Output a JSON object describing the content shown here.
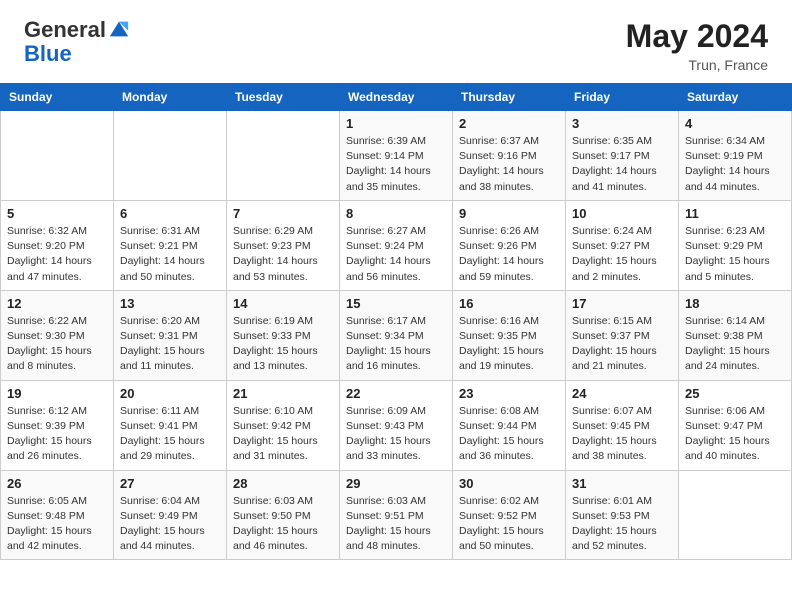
{
  "header": {
    "logo_general": "General",
    "logo_blue": "Blue",
    "month_year": "May 2024",
    "location": "Trun, France"
  },
  "days_of_week": [
    "Sunday",
    "Monday",
    "Tuesday",
    "Wednesday",
    "Thursday",
    "Friday",
    "Saturday"
  ],
  "weeks": [
    [
      {
        "day": "",
        "info": ""
      },
      {
        "day": "",
        "info": ""
      },
      {
        "day": "",
        "info": ""
      },
      {
        "day": "1",
        "info": "Sunrise: 6:39 AM\nSunset: 9:14 PM\nDaylight: 14 hours\nand 35 minutes."
      },
      {
        "day": "2",
        "info": "Sunrise: 6:37 AM\nSunset: 9:16 PM\nDaylight: 14 hours\nand 38 minutes."
      },
      {
        "day": "3",
        "info": "Sunrise: 6:35 AM\nSunset: 9:17 PM\nDaylight: 14 hours\nand 41 minutes."
      },
      {
        "day": "4",
        "info": "Sunrise: 6:34 AM\nSunset: 9:19 PM\nDaylight: 14 hours\nand 44 minutes."
      }
    ],
    [
      {
        "day": "5",
        "info": "Sunrise: 6:32 AM\nSunset: 9:20 PM\nDaylight: 14 hours\nand 47 minutes."
      },
      {
        "day": "6",
        "info": "Sunrise: 6:31 AM\nSunset: 9:21 PM\nDaylight: 14 hours\nand 50 minutes."
      },
      {
        "day": "7",
        "info": "Sunrise: 6:29 AM\nSunset: 9:23 PM\nDaylight: 14 hours\nand 53 minutes."
      },
      {
        "day": "8",
        "info": "Sunrise: 6:27 AM\nSunset: 9:24 PM\nDaylight: 14 hours\nand 56 minutes."
      },
      {
        "day": "9",
        "info": "Sunrise: 6:26 AM\nSunset: 9:26 PM\nDaylight: 14 hours\nand 59 minutes."
      },
      {
        "day": "10",
        "info": "Sunrise: 6:24 AM\nSunset: 9:27 PM\nDaylight: 15 hours\nand 2 minutes."
      },
      {
        "day": "11",
        "info": "Sunrise: 6:23 AM\nSunset: 9:29 PM\nDaylight: 15 hours\nand 5 minutes."
      }
    ],
    [
      {
        "day": "12",
        "info": "Sunrise: 6:22 AM\nSunset: 9:30 PM\nDaylight: 15 hours\nand 8 minutes."
      },
      {
        "day": "13",
        "info": "Sunrise: 6:20 AM\nSunset: 9:31 PM\nDaylight: 15 hours\nand 11 minutes."
      },
      {
        "day": "14",
        "info": "Sunrise: 6:19 AM\nSunset: 9:33 PM\nDaylight: 15 hours\nand 13 minutes."
      },
      {
        "day": "15",
        "info": "Sunrise: 6:17 AM\nSunset: 9:34 PM\nDaylight: 15 hours\nand 16 minutes."
      },
      {
        "day": "16",
        "info": "Sunrise: 6:16 AM\nSunset: 9:35 PM\nDaylight: 15 hours\nand 19 minutes."
      },
      {
        "day": "17",
        "info": "Sunrise: 6:15 AM\nSunset: 9:37 PM\nDaylight: 15 hours\nand 21 minutes."
      },
      {
        "day": "18",
        "info": "Sunrise: 6:14 AM\nSunset: 9:38 PM\nDaylight: 15 hours\nand 24 minutes."
      }
    ],
    [
      {
        "day": "19",
        "info": "Sunrise: 6:12 AM\nSunset: 9:39 PM\nDaylight: 15 hours\nand 26 minutes."
      },
      {
        "day": "20",
        "info": "Sunrise: 6:11 AM\nSunset: 9:41 PM\nDaylight: 15 hours\nand 29 minutes."
      },
      {
        "day": "21",
        "info": "Sunrise: 6:10 AM\nSunset: 9:42 PM\nDaylight: 15 hours\nand 31 minutes."
      },
      {
        "day": "22",
        "info": "Sunrise: 6:09 AM\nSunset: 9:43 PM\nDaylight: 15 hours\nand 33 minutes."
      },
      {
        "day": "23",
        "info": "Sunrise: 6:08 AM\nSunset: 9:44 PM\nDaylight: 15 hours\nand 36 minutes."
      },
      {
        "day": "24",
        "info": "Sunrise: 6:07 AM\nSunset: 9:45 PM\nDaylight: 15 hours\nand 38 minutes."
      },
      {
        "day": "25",
        "info": "Sunrise: 6:06 AM\nSunset: 9:47 PM\nDaylight: 15 hours\nand 40 minutes."
      }
    ],
    [
      {
        "day": "26",
        "info": "Sunrise: 6:05 AM\nSunset: 9:48 PM\nDaylight: 15 hours\nand 42 minutes."
      },
      {
        "day": "27",
        "info": "Sunrise: 6:04 AM\nSunset: 9:49 PM\nDaylight: 15 hours\nand 44 minutes."
      },
      {
        "day": "28",
        "info": "Sunrise: 6:03 AM\nSunset: 9:50 PM\nDaylight: 15 hours\nand 46 minutes."
      },
      {
        "day": "29",
        "info": "Sunrise: 6:03 AM\nSunset: 9:51 PM\nDaylight: 15 hours\nand 48 minutes."
      },
      {
        "day": "30",
        "info": "Sunrise: 6:02 AM\nSunset: 9:52 PM\nDaylight: 15 hours\nand 50 minutes."
      },
      {
        "day": "31",
        "info": "Sunrise: 6:01 AM\nSunset: 9:53 PM\nDaylight: 15 hours\nand 52 minutes."
      },
      {
        "day": "",
        "info": ""
      }
    ]
  ]
}
